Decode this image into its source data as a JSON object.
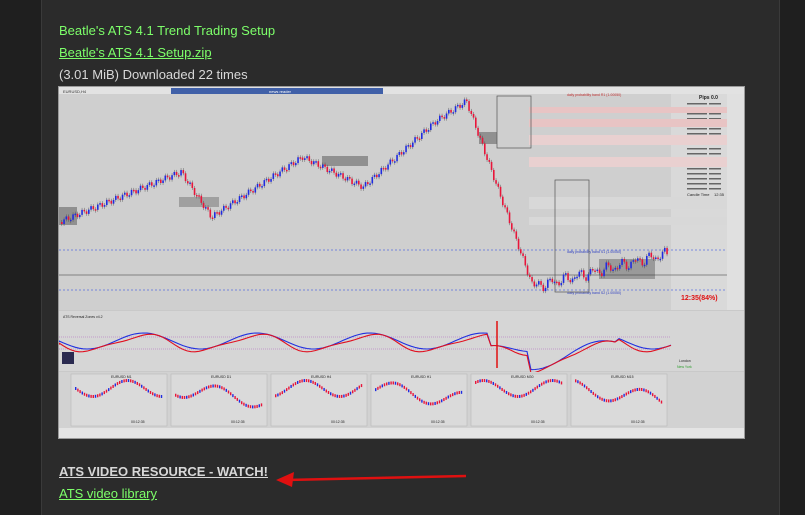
{
  "post": {
    "title": "Beatle's ATS 4.1 Trend Trading Setup",
    "attachment_name": "Beatle's ATS 4.1 Setup.zip",
    "attachment_info": "(3.01 MiB) Downloaded 22 times",
    "video_resource_link": "ATS VIDEO RESOURCE - WATCH!",
    "video_library_link": "ATS video library"
  },
  "screenshot": {
    "chart_symbol": "EURUSD,H4",
    "header_box": "news reader",
    "pips_label": "Pips 0.0",
    "upper_band_label": "daily probability band R1 (1.00050)",
    "middle_band_label": "daily probability band S1 (1.00050)",
    "lower_band_label": "daily probability band S2 (1.00050)",
    "clock": "12:35(84%)",
    "candle_time_label": "Candle Time",
    "candle_time_value": "12:35",
    "mini_charts": [
      {
        "label": "EURUSD M1"
      },
      {
        "label": "EURUSD D1"
      },
      {
        "label": "EURUSD H4"
      },
      {
        "label": "EURUSD H1"
      },
      {
        "label": "EURUSD M30"
      },
      {
        "label": "EURUSD M15"
      }
    ],
    "mini_times": [
      "00:12:35",
      "00:12:35",
      "00:12:35",
      "00:12:35",
      "00:12:35",
      "00:12:35"
    ],
    "session_london": "London",
    "session_newyork": "New York",
    "indicator_title": "ATS Reversal Zones v4.2"
  },
  "colors": {
    "link_green": "#7dff6a",
    "arrow_red": "#e01010",
    "bull": "#1f2be0",
    "bear": "#e8153a"
  }
}
